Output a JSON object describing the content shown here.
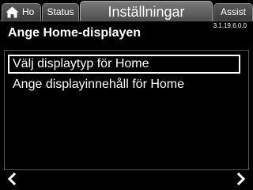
{
  "tabs": [
    {
      "label": "Ho",
      "icon": "home-icon",
      "active": false
    },
    {
      "label": "Status",
      "active": false
    },
    {
      "label": "Inställningar",
      "active": true
    },
    {
      "label": "Assist",
      "active": false
    }
  ],
  "header": {
    "version": "3.1.19.6.0.0",
    "title": "Ange Home-displayen"
  },
  "menu": {
    "items": [
      {
        "label": "Välj displaytyp för Home",
        "selected": true
      },
      {
        "label": "Ange displayinnehåll för Home",
        "selected": false
      }
    ]
  },
  "nav": {
    "left_icon": "chevron-left-icon",
    "right_icon": "chevron-right-icon"
  },
  "colors": {
    "background": "#000000",
    "text": "#ffffff",
    "tab": "#4a4a4a",
    "tab_active": "#666666"
  }
}
